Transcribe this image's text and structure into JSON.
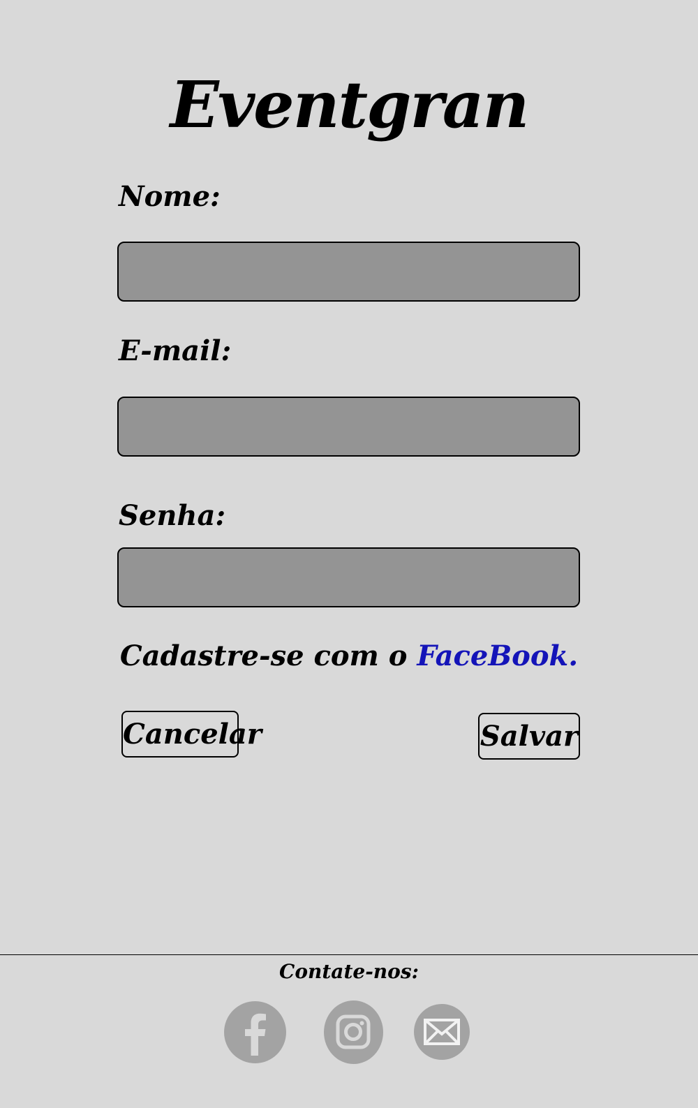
{
  "app": {
    "title": "Eventgran"
  },
  "form": {
    "name_label": "Nome:",
    "name_value": "",
    "name_placeholder": "",
    "email_label": "E-mail:",
    "email_value": "",
    "email_placeholder": "",
    "password_label": "Senha:",
    "password_value": "",
    "password_placeholder": ""
  },
  "facebook_signup": {
    "prefix": "Cadastre-se com o ",
    "link_text": "FaceBook."
  },
  "actions": {
    "cancel_label": "Cancelar",
    "save_label": "Salvar"
  },
  "footer": {
    "title": "Contate-nos:",
    "social": [
      {
        "icon": "facebook-icon"
      },
      {
        "icon": "instagram-icon"
      },
      {
        "icon": "mail-icon"
      }
    ]
  },
  "colors": {
    "background": "#d9d9d9",
    "input_fill": "#949494",
    "link": "#1414b8",
    "social_icon_bg": "#a3a3a3"
  }
}
